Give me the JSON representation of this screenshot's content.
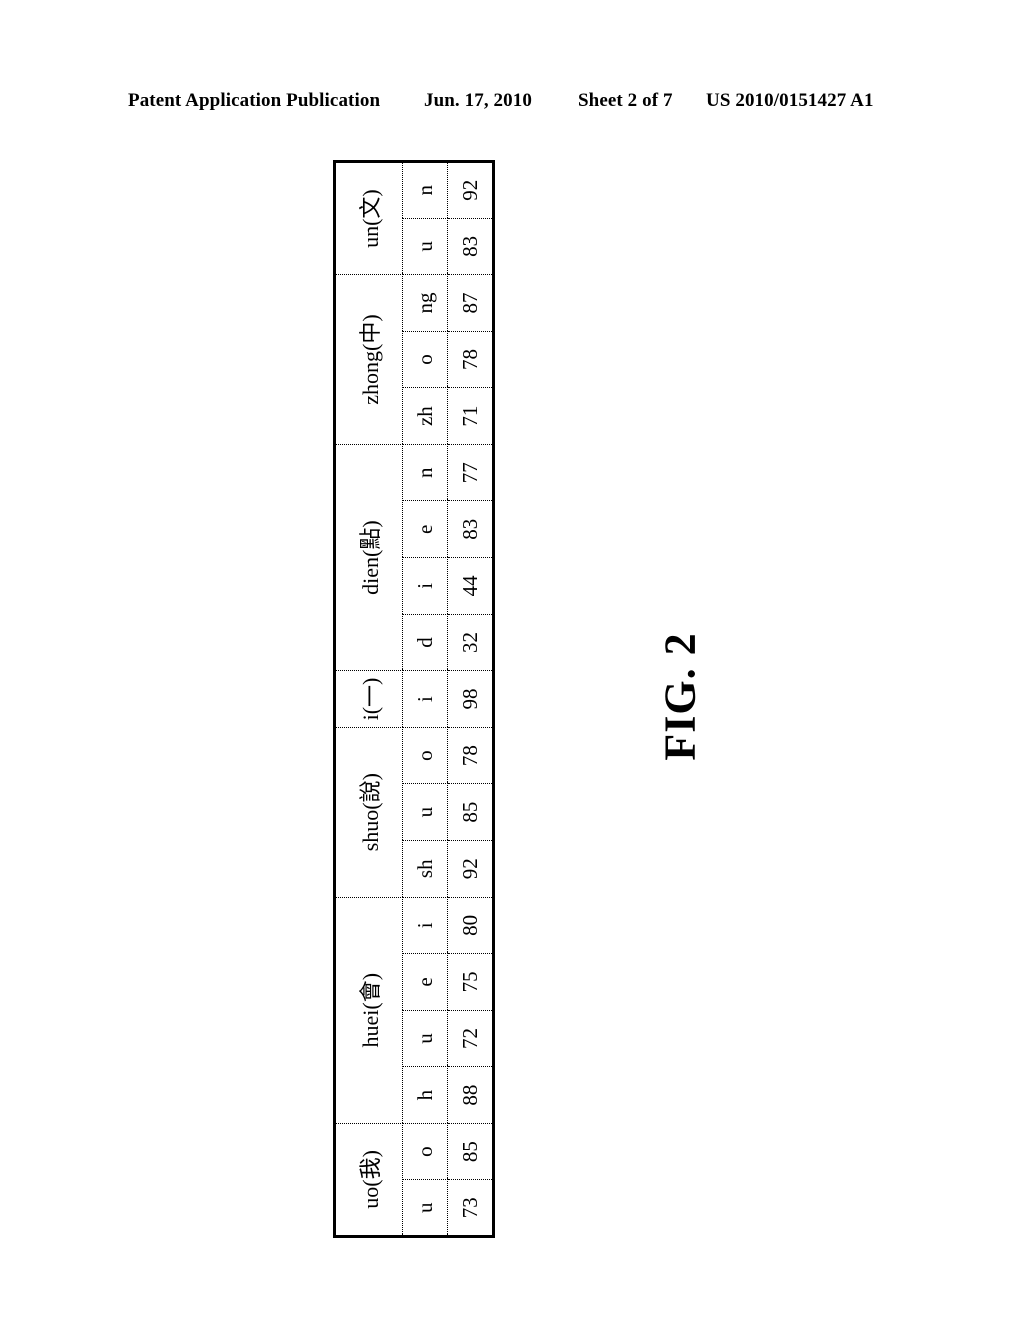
{
  "header": {
    "publication": "Patent Application Publication",
    "date": "Jun. 17, 2010",
    "sheet": "Sheet 2 of 7",
    "patent_number": "US 2010/0151427 A1"
  },
  "figure": {
    "label": "FIG. 2"
  },
  "table": {
    "orientation": "rotated-90-ccw",
    "groups": [
      {
        "word": "uo(我)",
        "units": [
          "u",
          "o"
        ],
        "scores": [
          73,
          85
        ]
      },
      {
        "word": "huei(會)",
        "units": [
          "h",
          "u",
          "e",
          "i"
        ],
        "scores": [
          88,
          72,
          75,
          80
        ]
      },
      {
        "word": "shuo(說)",
        "units": [
          "sh",
          "u",
          "o"
        ],
        "scores": [
          92,
          85,
          78
        ]
      },
      {
        "word": "i(一)",
        "units": [
          "i"
        ],
        "scores": [
          98
        ]
      },
      {
        "word": "dien(點)",
        "units": [
          "d",
          "i",
          "e",
          "n"
        ],
        "scores": [
          32,
          44,
          83,
          77
        ]
      },
      {
        "word": "zhong(中)",
        "units": [
          "zh",
          "o",
          "ng"
        ],
        "scores": [
          71,
          78,
          87
        ]
      },
      {
        "word": "un(文)",
        "units": [
          "u",
          "n"
        ],
        "scores": [
          83,
          92
        ]
      }
    ]
  }
}
